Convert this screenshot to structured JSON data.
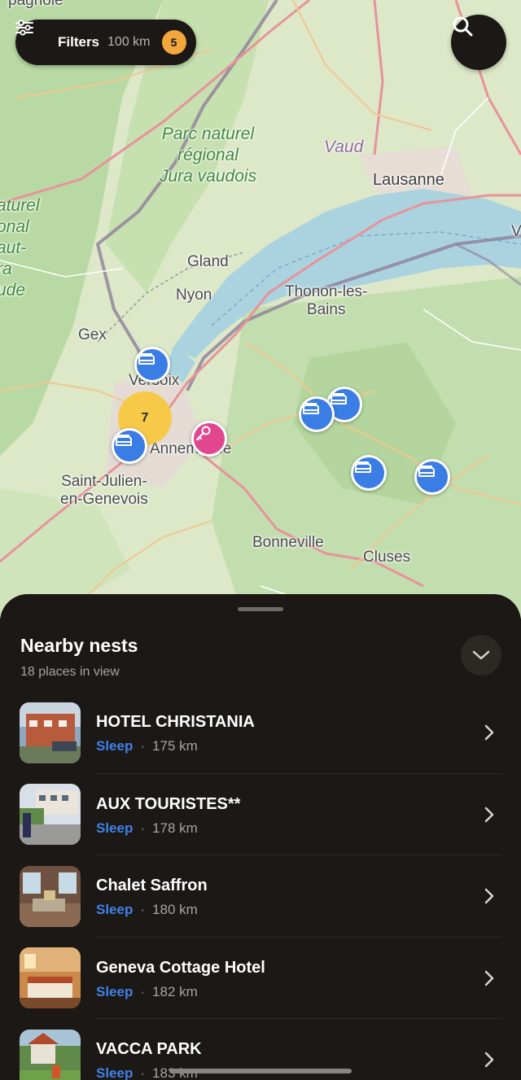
{
  "filters": {
    "label": "Filters",
    "distance": "100 km",
    "count": "5"
  },
  "map": {
    "labels": {
      "park": "Parc naturel\nrégional\nJura vaudois",
      "vaud": "Vaud",
      "lausanne": "Lausanne",
      "gland": "Gland",
      "nyon": "Nyon",
      "thonon": "Thonon-les-\nBains",
      "gex": "Gex",
      "versoix": "Versoix",
      "annemasse": "Annemasse",
      "stjulien": "Saint-Julien-\nen-Genevois",
      "bonneville": "Bonneville",
      "cluses": "Cluses",
      "left_edge": "aturel\nonal\naut-\nra\nude",
      "top_edge": "pagnole",
      "right_edge": "V"
    },
    "cluster_count": "7"
  },
  "sheet": {
    "title": "Nearby nests",
    "subtitle": "18 places in view",
    "items": [
      {
        "name": "HOTEL CHRISTANIA",
        "category": "Sleep",
        "distance": "175 km"
      },
      {
        "name": "AUX TOURISTES**",
        "category": "Sleep",
        "distance": "178 km"
      },
      {
        "name": "Chalet Saffron",
        "category": "Sleep",
        "distance": "180 km"
      },
      {
        "name": "Geneva Cottage Hotel",
        "category": "Sleep",
        "distance": "182 km"
      },
      {
        "name": "VACCA PARK",
        "category": "Sleep",
        "distance": "183 km"
      }
    ]
  },
  "colors": {
    "accent_blue": "#3a7de4",
    "cluster_yellow": "#f7c948",
    "key_pink": "#e2468f",
    "badge_orange": "#f2a63b",
    "sheet_bg": "#1b1815"
  }
}
